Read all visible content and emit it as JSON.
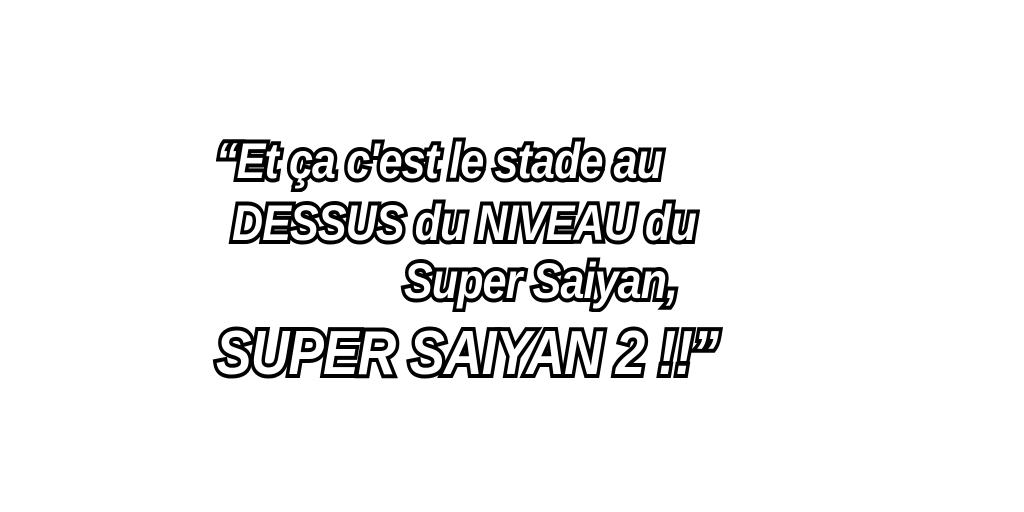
{
  "quote": {
    "line1": "“Et ça c'est le stade au",
    "line2": "DESSUS du NIVEAU du",
    "line3": "Super Saiyan,",
    "line4": "SUPER SAIYAN 2 !!”"
  },
  "colors": {
    "background": "#ffffff",
    "text_fill": "#ffffff",
    "text_outline": "#000000"
  }
}
